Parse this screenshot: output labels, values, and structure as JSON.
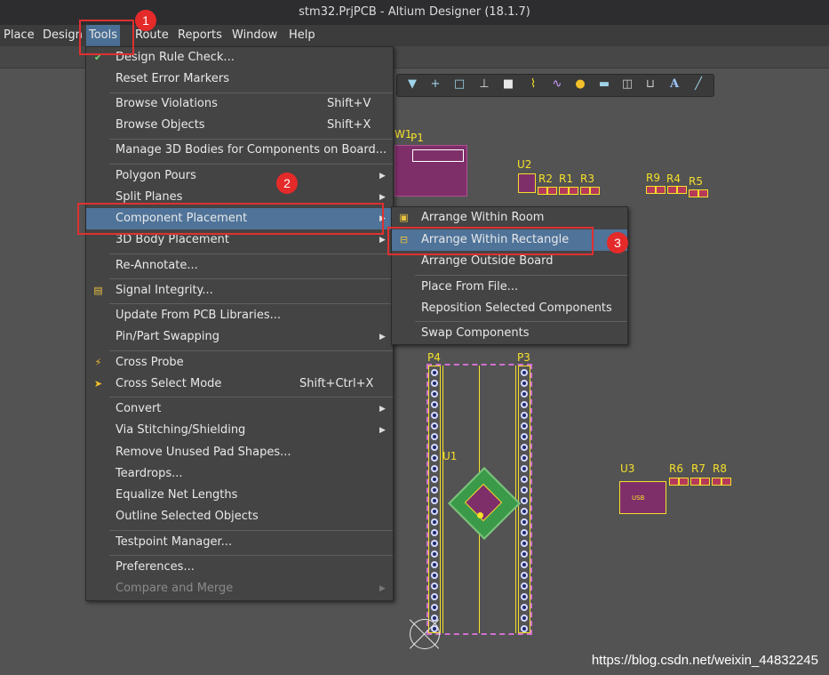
{
  "window": {
    "title": "stm32.PrjPCB - Altium Designer (18.1.7)"
  },
  "menubar": [
    "Place",
    "Design",
    "Tools",
    "Route",
    "Reports",
    "Window",
    "Help"
  ],
  "tools_menu": {
    "items": [
      {
        "label": "Design Rule Check...",
        "shortcut": "",
        "submenu": false,
        "icon": "drc-icon"
      },
      {
        "label": "Reset Error Markers",
        "shortcut": "",
        "submenu": false
      },
      {
        "label": "Browse Violations",
        "shortcut": "Shift+V",
        "submenu": false
      },
      {
        "label": "Browse Objects",
        "shortcut": "Shift+X",
        "submenu": false
      },
      {
        "label": "Manage 3D Bodies for Components on Board...",
        "shortcut": "",
        "submenu": false
      },
      {
        "label": "Polygon Pours",
        "shortcut": "",
        "submenu": true
      },
      {
        "label": "Split Planes",
        "shortcut": "",
        "submenu": true
      },
      {
        "label": "Component Placement",
        "shortcut": "",
        "submenu": true,
        "highlighted": true
      },
      {
        "label": "3D Body Placement",
        "shortcut": "",
        "submenu": true
      },
      {
        "label": "Re-Annotate...",
        "shortcut": "",
        "submenu": false
      },
      {
        "label": "Signal Integrity...",
        "shortcut": "",
        "submenu": false,
        "icon": "signal-integrity-icon"
      },
      {
        "label": "Update From PCB Libraries...",
        "shortcut": "",
        "submenu": false
      },
      {
        "label": "Pin/Part Swapping",
        "shortcut": "",
        "submenu": true
      },
      {
        "label": "Cross Probe",
        "shortcut": "",
        "submenu": false,
        "icon": "cross-probe-icon"
      },
      {
        "label": "Cross Select Mode",
        "shortcut": "Shift+Ctrl+X",
        "submenu": false,
        "icon": "cross-select-icon"
      },
      {
        "label": "Convert",
        "shortcut": "",
        "submenu": true
      },
      {
        "label": "Via Stitching/Shielding",
        "shortcut": "",
        "submenu": true
      },
      {
        "label": "Remove Unused Pad Shapes...",
        "shortcut": "",
        "submenu": false
      },
      {
        "label": "Teardrops...",
        "shortcut": "",
        "submenu": false
      },
      {
        "label": "Equalize Net Lengths",
        "shortcut": "",
        "submenu": false
      },
      {
        "label": "Outline Selected Objects",
        "shortcut": "",
        "submenu": false
      },
      {
        "label": "Testpoint Manager...",
        "shortcut": "",
        "submenu": false
      },
      {
        "label": "Preferences...",
        "shortcut": "",
        "submenu": false
      },
      {
        "label": "Compare and Merge",
        "shortcut": "",
        "submenu": true,
        "disabled": true
      }
    ]
  },
  "placement_submenu": {
    "items": [
      {
        "label": "Arrange Within Room",
        "icon": "arrange-room-icon"
      },
      {
        "label": "Arrange Within Rectangle",
        "icon": "arrange-rect-icon",
        "highlighted": true
      },
      {
        "label": "Arrange Outside Board"
      },
      {
        "label": "Place From File..."
      },
      {
        "label": "Reposition Selected Components"
      },
      {
        "label": "Swap Components"
      }
    ]
  },
  "pcb_labels": {
    "w1": "W1",
    "p1": "P1",
    "u2": "U2",
    "r2": "R2",
    "r1": "R1",
    "r3": "R3",
    "r9": "R9",
    "r4": "R4",
    "r5": "R5",
    "p4": "P4",
    "p3": "P3",
    "u1": "U1",
    "u3": "U3",
    "r6": "R6",
    "r7": "R7",
    "r8": "R8",
    "usb": "USB"
  },
  "annotations": {
    "badge1": "1",
    "badge2": "2",
    "badge3": "3"
  },
  "watermark": "https://blog.csdn.net/weixin_44832245",
  "colors": {
    "highlight": "#4f7399",
    "menu_bg": "#444444",
    "canvas": "#535353",
    "silkscreen": "#f5e02a",
    "annotation": "#e03030"
  }
}
